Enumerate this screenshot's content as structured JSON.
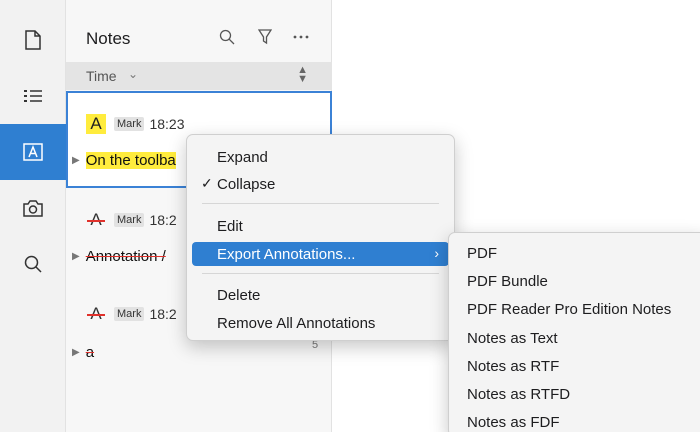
{
  "rail": {
    "items": [
      "document-icon",
      "list-icon",
      "annotation-icon",
      "snapshot-icon",
      "search-icon"
    ],
    "active": "annotation-icon"
  },
  "notes": {
    "title": "Notes",
    "sort_label": "Time",
    "cards": [
      {
        "type": "highlight",
        "badge": "Mark",
        "time": "18:23",
        "excerpt": "On the toolba"
      },
      {
        "type": "strikeout",
        "badge": "Mark",
        "time": "18:2",
        "excerpt": "Annotation /"
      },
      {
        "type": "strikeout",
        "badge": "Mark",
        "time": "18:2",
        "excerpt": "a",
        "count": "5"
      }
    ]
  },
  "context_menu": {
    "expand": "Expand",
    "collapse": "Collapse",
    "edit": "Edit",
    "export": "Export Annotations...",
    "delete": "Delete",
    "remove_all": "Remove All Annotations"
  },
  "export_submenu": [
    "PDF",
    "PDF Bundle",
    "PDF Reader Pro Edition Notes",
    "Notes as Text",
    "Notes as RTF",
    "Notes as RTFD",
    "Notes as FDF"
  ],
  "colors": {
    "accent": "#2f7fd1",
    "highlight": "#ffec3d",
    "strike": "#e0312b"
  }
}
